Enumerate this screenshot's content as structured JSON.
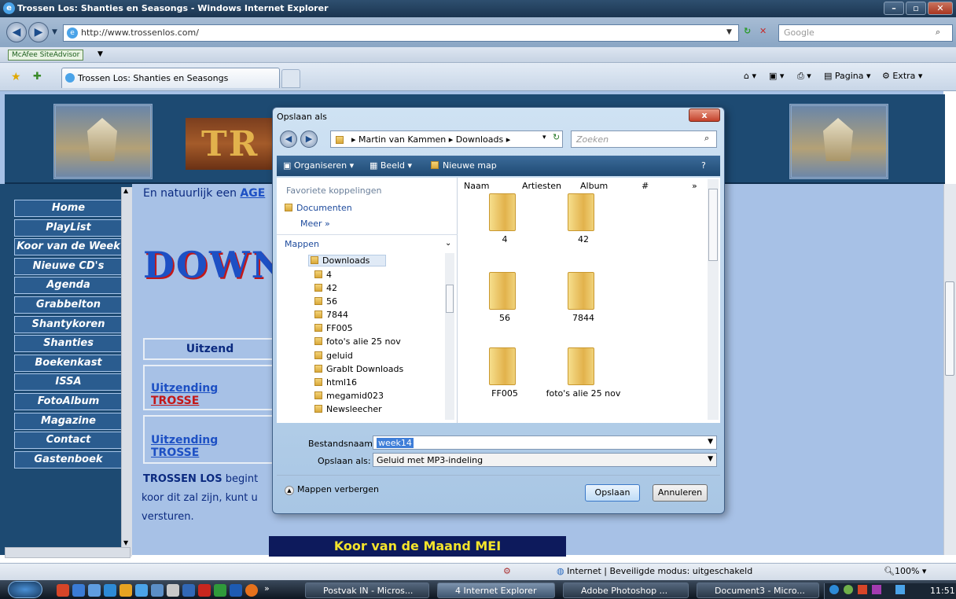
{
  "window": {
    "title": "Trossen Los: Shanties en Seasongs - Windows Internet Explorer",
    "min": "–",
    "max": "▫",
    "close": "✕"
  },
  "nav": {
    "url": "http://www.trossenlos.com/",
    "search_placeholder": "Google"
  },
  "toolbar": {
    "mcafee": "McAfee SiteAdvisor",
    "tab_title": "Trossen Los: Shanties en Seasongs",
    "pagina": "Pagina",
    "extra": "Extra"
  },
  "site": {
    "logo": "TR",
    "menu": [
      "Home",
      "PlayList",
      "Koor van de Week",
      "Nieuwe CD's",
      "Agenda",
      "Grabbelton",
      "Shantykoren",
      "Shanties",
      "Boekenkast",
      "ISSA",
      "FotoAlbum",
      "Magazine",
      "Contact",
      "Gastenboek"
    ],
    "intro": "En natuurlijk een",
    "intro_link": "AGE",
    "download_heading": "DOWNL",
    "uitzend_header": "Uitzend",
    "uitzend1_a": "Uitzending",
    "uitzend1_b": "TROSSE",
    "uitzend2": "Uitzending TROSSE",
    "para_1": "TROSSEN LOS",
    "para_2": "begint",
    "para_line2": "koor dit zal zijn, kunt u",
    "para_line3": "versturen.",
    "koor_maand": "Koor van de Maand MEI"
  },
  "dialog": {
    "title": "Opslaan als",
    "path": [
      "Martin van Kammen",
      "Downloads"
    ],
    "search_placeholder": "Zoeken",
    "tools": {
      "organiseren": "Organiseren",
      "beeld": "Beeld",
      "nieuwe_map": "Nieuwe map"
    },
    "favorites_header": "Favoriete koppelingen",
    "favorites": [
      "Documenten"
    ],
    "more": "Meer",
    "folders_header": "Mappen",
    "tree_root": "Downloads",
    "tree": [
      "4",
      "42",
      "56",
      "7844",
      "FF005",
      "foto's alie 25 nov",
      "geluid",
      "GrabIt Downloads",
      "html16",
      "megamid023",
      "Newsleecher"
    ],
    "columns": [
      "Naam",
      "Artiesten",
      "Album",
      "#"
    ],
    "files": [
      "4",
      "42",
      "56",
      "7844",
      "FF005",
      "foto's alie 25 nov"
    ],
    "filename_label": "Bestandsnaam:",
    "filename": "week14",
    "savetype_label": "Opslaan als:",
    "savetype": "Geluid met MP3-indeling",
    "hide_folders": "Mappen verbergen",
    "save": "Opslaan",
    "cancel": "Annuleren"
  },
  "status": {
    "zone": "Internet | Beveiligde modus: uitgeschakeld",
    "zoom": "100%"
  },
  "taskbar": {
    "items": [
      "Postvak IN - Micros...",
      "4 Internet Explorer",
      "Adobe Photoshop ...",
      "Document3 - Micro..."
    ],
    "clock": "11:51"
  }
}
